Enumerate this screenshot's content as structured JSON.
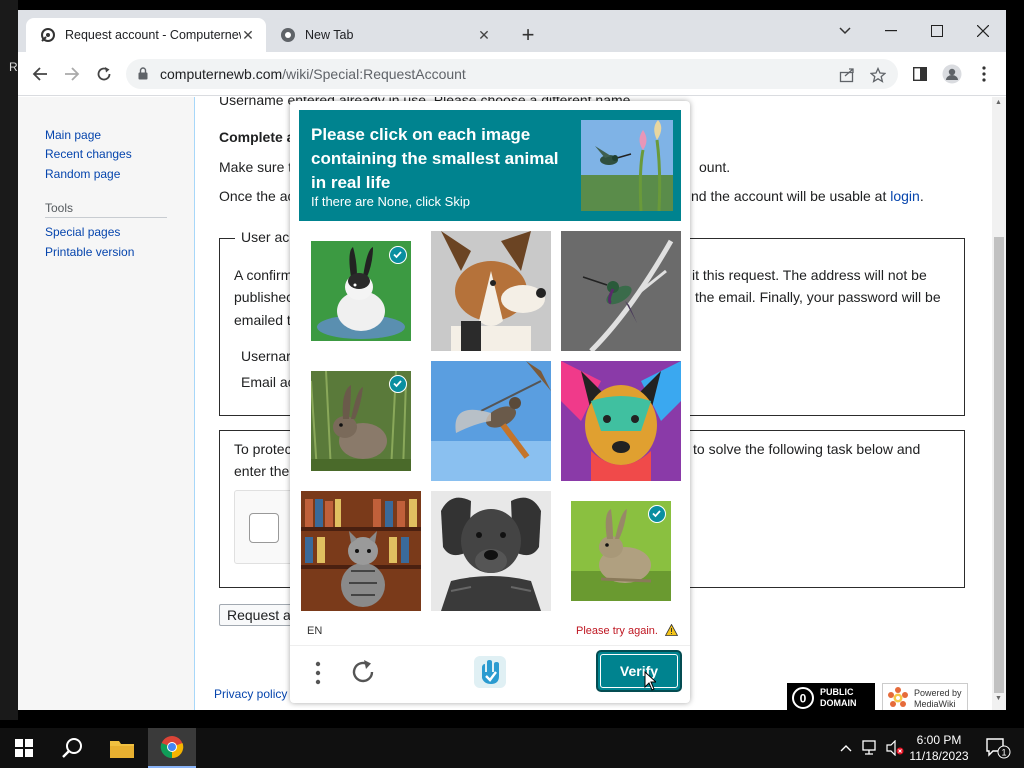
{
  "browser": {
    "tabs": [
      {
        "title": "Request account - Computernewb",
        "active": true
      },
      {
        "title": "New Tab",
        "active": false
      }
    ],
    "url": {
      "domain": "computernewb.com",
      "path": "/wiki/Special:RequestAccount"
    }
  },
  "desktop": {
    "edge_letter": "R"
  },
  "sidebar": {
    "nav": [
      "Main page",
      "Recent changes",
      "Random page"
    ],
    "tools_heading": "Tools",
    "tools": [
      "Special pages",
      "Printable version"
    ]
  },
  "page": {
    "notice": "Username entered already in use. Please choose a different name.",
    "heading": "Complete a",
    "line1_left": "Make sure t",
    "line1_right": "ount.",
    "line2_left": "Once the ac",
    "line2_right": "nd the account will be usable at",
    "login_link": "login",
    "line2_end": ".",
    "user_legend": "User ac",
    "confirm_left": [
      "A confirm",
      "publishec",
      "emailed t"
    ],
    "confirm_right": [
      "it this request. The address will not be",
      "the email. Finally, your password will be"
    ],
    "username_label": "Usernar",
    "email_label": "Email ac",
    "protect_left": [
      "To protec",
      "enter the"
    ],
    "protect_right": "to solve the following task below and",
    "submit_label": "Request ac",
    "privacy_link": "Privacy policy",
    "badges": {
      "pd": [
        "PUBLIC",
        "DOMAIN"
      ],
      "mw": [
        "Powered by",
        "MediaWiki"
      ]
    }
  },
  "captcha": {
    "prompt": "Please click on each image containing the smallest animal in real life",
    "subprompt": "If there are None, click Skip",
    "tiles": [
      {
        "subject": "rabbit",
        "selected": true
      },
      {
        "subject": "dog",
        "selected": false
      },
      {
        "subject": "hummingbird",
        "selected": false
      },
      {
        "subject": "rabbit",
        "selected": true
      },
      {
        "subject": "hummingbird",
        "selected": false
      },
      {
        "subject": "dog",
        "selected": false
      },
      {
        "subject": "cat",
        "selected": false
      },
      {
        "subject": "dog",
        "selected": false
      },
      {
        "subject": "rabbit",
        "selected": true
      }
    ],
    "language": "EN",
    "error": "Please try again.",
    "verify_label": "Verify",
    "accent": "#00838f",
    "error_color": "#bf1722"
  },
  "taskbar": {
    "time": "6:00 PM",
    "date": "11/18/2023",
    "notification_count": "1"
  }
}
